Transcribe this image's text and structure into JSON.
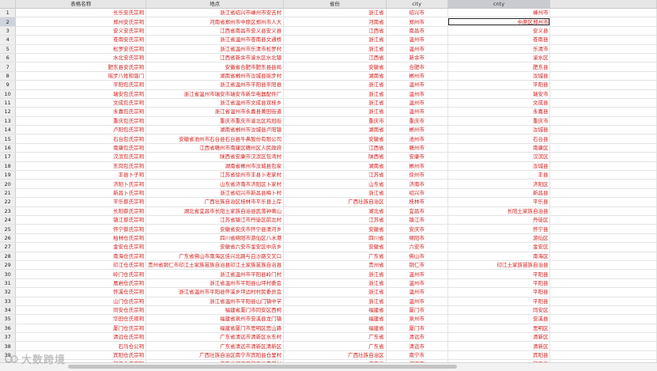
{
  "columns": [
    "表格名称",
    "地点",
    "省份",
    "city",
    "cnty"
  ],
  "active_cell": {
    "row": 2,
    "col": 5
  },
  "rows": [
    [
      "长乐安氏宗祠",
      "浙江省绍兴市嵊州市安吉村",
      "浙江省",
      "绍兴市",
      "嵊州市"
    ],
    [
      "郑州安氏宗祠",
      "河南省郑州市中原区郑州市人大",
      "河南省",
      "郑州市",
      "中原区郑州市"
    ],
    [
      "安义安氏宗祠",
      "江西省南昌市安义县安义县",
      "江西省",
      "南昌市",
      "安义县"
    ],
    [
      "苍南安氏宗祠",
      "浙江省温州市苍南县文通桥",
      "浙江省",
      "温州市",
      "苍南县"
    ],
    [
      "松罗安氏宗祠",
      "浙江省温州市乐清市松罗村",
      "浙江省",
      "温州市",
      "乐清市"
    ],
    [
      "水北安氏宗祠",
      "江西省新余市渝水区水北镇",
      "江西省",
      "新余市",
      "渝水区"
    ],
    [
      "肥东县安氏宗祠",
      "安徽省合肥市肥东县县局",
      "安徽省",
      "合肥市",
      "肥东县"
    ],
    [
      "瑶步八姓和谐门",
      "湖南省郴州市汝城县瑶步村",
      "湖南省",
      "郴州市",
      "汝城县"
    ],
    [
      "平阳包氏宗祠",
      "浙江省温州市平阳县平阳县",
      "浙江省",
      "温州市",
      "平阳县"
    ],
    [
      "瑞安包氏宗祠",
      "浙江省温州市瑞安市瑞安市新华电器配件厂",
      "浙江省",
      "温州市",
      "瑞安市"
    ],
    [
      "文成包氏宗祠",
      "浙江省温州市文成县双桂乡",
      "浙江省",
      "温州市",
      "文成县"
    ],
    [
      "永嘉包氏宗祠",
      "浙江省温州市永嘉县黄田街道",
      "浙江省",
      "温州市",
      "永嘉县"
    ],
    [
      "重庆包氏宗祠",
      "重庆市重庆市渝北区鸡冠街",
      "重庆市",
      "重庆市",
      "重庆市"
    ],
    [
      "卢阳包氏宗祠",
      "湖南省郴州市汝城县卢阳镇",
      "湖南省",
      "郴州市",
      "汝城县"
    ],
    [
      "石台包氏宗祠",
      "安徽省池州市石台县石台县牛鼻股份有限公司",
      "安徽省",
      "池州市",
      "石台县"
    ],
    [
      "南康包氏宗祠",
      "江西省赣州市南康区赣州区人民政府",
      "江西省",
      "赣州市",
      "南康区"
    ],
    [
      "汉滨包氏宗祠",
      "陕西省安康市汉滨区包湾村",
      "陕西省",
      "安康市",
      "汉滨区"
    ],
    [
      "东岗包氏宗祠",
      "湖南省郴州市汝城县包家",
      "湖南省",
      "郴州市",
      "汝城县"
    ],
    [
      "丰县卜子祠",
      "江苏省徐州市丰县卜老家村",
      "江苏省",
      "徐州市",
      "丰县"
    ],
    [
      "济阳卜氏宗祠",
      "山东省济南市济阳区卜家村",
      "山东省",
      "济南市",
      "济阳区"
    ],
    [
      "新昌卜氏宗祠",
      "浙江省绍兴市新昌县梅卜村",
      "浙江省",
      "绍兴市",
      "新昌县"
    ],
    [
      "平乐蔡氏宗祠",
      "广西壮族自治区桂林市平乐县上岸",
      "广西壮族自治区",
      "桂林市",
      "平乐县"
    ],
    [
      "长阳蔡氏宗祠",
      "湖北省宜昌市长阳土家族自治县武落钟离山",
      "湖北省",
      "宜昌市",
      "长阳土家族自治县"
    ],
    [
      "镇江蔡氏宗祠",
      "江苏省镇江市丹徒区前北村",
      "江苏省",
      "镇江市",
      "丹徒区"
    ],
    [
      "怀宁蔡氏宗祠",
      "安徽省安庆市怀宁县清河乡",
      "安徽省",
      "安庆市",
      "怀宁县"
    ],
    [
      "柏林仓氏宗祠",
      "四川省绵阳市游仙区八水港",
      "四川省",
      "绵阳市",
      "游仙区"
    ],
    [
      "金安仓氏宗祠",
      "安徽省六安市金安区中店乡",
      "安徽省",
      "六安市",
      "金安区"
    ],
    [
      "南海仓氏宗祠",
      "广东省佛山市南海区佳兴北路与白沙路交叉口",
      "广东省",
      "佛山市",
      "南海区"
    ],
    [
      "印江仓氏宗祠",
      "贵州省铜仁市印江土家族苗族自治县印江土家族苗族自治县",
      "贵州省",
      "铜仁市",
      "印江土家族苗族自治县"
    ],
    [
      "岭门仓氏宗祠",
      "浙江省温州市平阳县岭门村",
      "浙江省",
      "温州市",
      "平阳县"
    ],
    [
      "凰岩仓氏宗祠",
      "浙江省温州市平阳县山坪村委会",
      "浙江省",
      "温州市",
      "平阳县"
    ],
    [
      "怀溪仓氏宗祠",
      "浙江省温州市平阳县怀溪乡坪边村村民委员会",
      "浙江省",
      "温州市",
      "平阳县"
    ],
    [
      "山门仓氏宗祠",
      "浙江省温州市平阳县山门镇中学",
      "浙江省",
      "温州市",
      "平阳县"
    ],
    [
      "同安仓氏宗祠",
      "福建省厦门市同安区西柯",
      "福建省",
      "厦门市",
      "同安区"
    ],
    [
      "华田仓氏祖祠",
      "福建省泉州市安溪县龙门镇",
      "福建省",
      "泉州市",
      "安溪县"
    ],
    [
      "厦门仓氏宗祠",
      "福建省厦门市思明区思山路",
      "福建省",
      "厦门市",
      "思明区"
    ],
    [
      "清远仓氏宗祠",
      "广东省清远市清新区水东村",
      "广东省",
      "清远市",
      "清新区"
    ],
    [
      "石马仓公祠",
      "广东省清远市清新区清新区",
      "广东省",
      "清远市",
      "清新区"
    ],
    [
      "宾阳仓氏宗祠",
      "广西壮族自治区南宁市宾阳县仓里村",
      "广西壮族自治区",
      "南宁市",
      "宾阳县"
    ],
    [
      "和平仓氏宗祠",
      "广东省河源市和平县贵田村",
      "广东省",
      "河源市",
      "和平县"
    ]
  ],
  "watermark": {
    "text": "大数跨境",
    "icon": "brand-logo-icon"
  }
}
